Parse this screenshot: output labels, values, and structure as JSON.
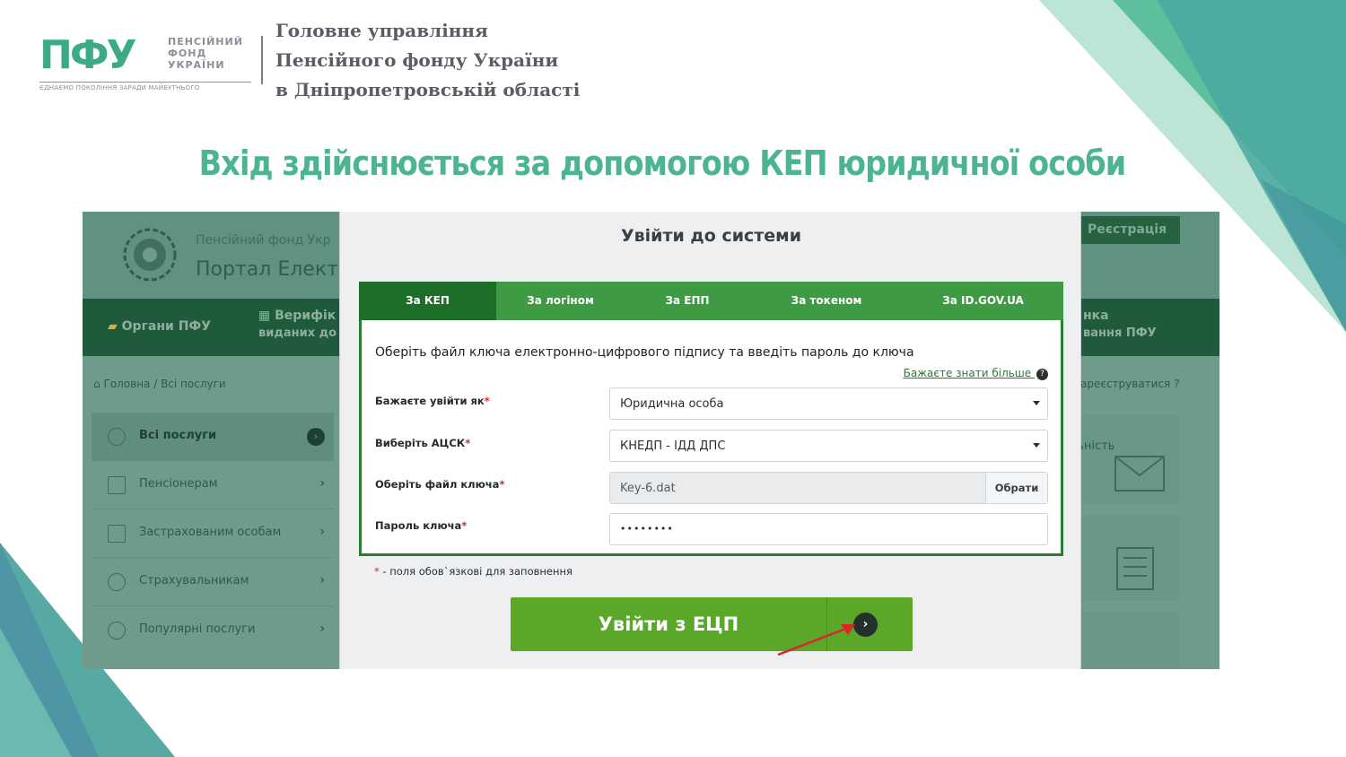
{
  "colors": {
    "accent_teal": "#4db493",
    "pfu_green": "#3daa87",
    "tab_green": "#3f9a44",
    "tab_active": "#1c6e29",
    "login_button": "#5aa72a",
    "required_red": "#d9262b"
  },
  "logo": {
    "mark": "ПФУ",
    "words": [
      "ПЕНСІЙНИЙ",
      "ФОНД",
      "УКРАЇНИ"
    ],
    "tagline": "ЄДНАЄМО ПОКОЛІННЯ ЗАРАДИ МАЙБУТНЬОГО"
  },
  "header": {
    "org_lines": [
      "Головне управління",
      "Пенсійного фонду України",
      "в Дніпропетровській області"
    ]
  },
  "slide": {
    "title": "Вхід здійснюється за допомогою КЕП юридичної особи"
  },
  "portal": {
    "site_name": "Пенсійний фонд Укр",
    "site_subtitle": "Портал Електр",
    "register_button": "Реєстрація",
    "nav": [
      {
        "label": "Органи ПФУ",
        "icon": "ukraine-map-icon"
      },
      {
        "label": "Верифік",
        "sublabel": "виданих до",
        "icon": "qr-code-icon"
      },
      {
        "label": "нка",
        "sublabel": "вання ПФУ"
      }
    ],
    "breadcrumb": "Головна / Всі послуги",
    "register_hint": "ареєструватися",
    "sidebar": [
      {
        "label": "Всі послуги",
        "active": true,
        "icon": "list-icon"
      },
      {
        "label": "Пенсіонерам",
        "icon": "envelope-icon"
      },
      {
        "label": "Застрахованим особам",
        "icon": "document-icon"
      },
      {
        "label": "Страхувальникам",
        "icon": "info-icon"
      },
      {
        "label": "Популярні послуги",
        "icon": "star-icon"
      }
    ],
    "card_text": "льність"
  },
  "modal": {
    "title": "Увійти до системи",
    "tabs": [
      {
        "label": "За КЕП",
        "active": true
      },
      {
        "label": "За логіном"
      },
      {
        "label": "За ЕПП"
      },
      {
        "label": "За токеном"
      },
      {
        "label": "За ID.GOV.UA"
      }
    ],
    "intro": "Оберіть файл ключа електронно-цифрового підпису та введіть пароль до ключа",
    "learn_more": "Бажаєте знати більше",
    "fields": {
      "login_as": {
        "label": "Бажаєте увійти як",
        "value": "Юридична особа"
      },
      "acsk": {
        "label": "Виберіть АЦСК",
        "value": "КНЕДП - ІДД ДПС"
      },
      "key_file": {
        "label": "Оберіть файл ключа",
        "value": "Key-6.dat",
        "button": "Обрати"
      },
      "password": {
        "label": "Пароль ключа",
        "value": "••••••••"
      }
    },
    "required_mark": "*",
    "required_note": "- поля обов`язкові для заповнення",
    "submit_label": "Увійти з ЕЦП"
  }
}
